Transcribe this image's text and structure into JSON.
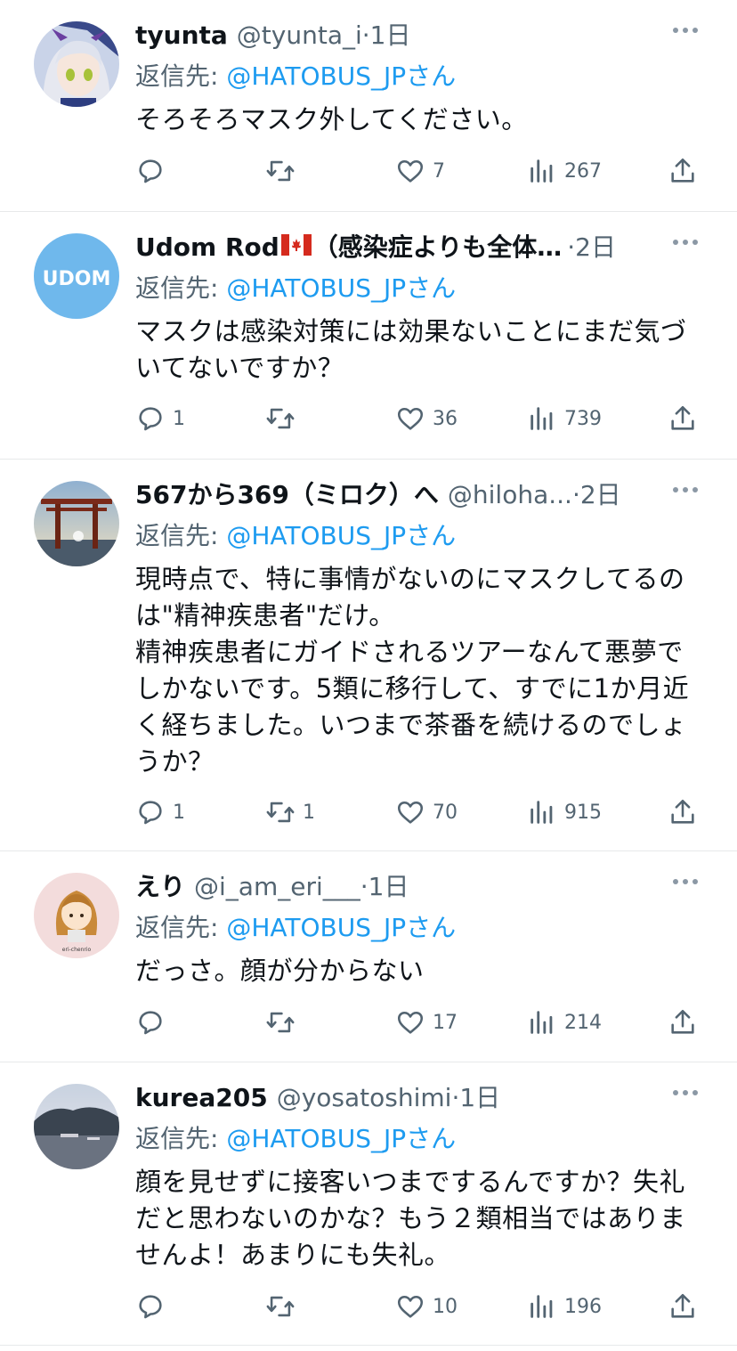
{
  "tweets": [
    {
      "name": "tyunta",
      "handle": "@tyunta_i",
      "time": "1日",
      "reply_prefix": "返信先:",
      "reply_to": "@HATOBUS_JPさん",
      "text": "そろそろマスク外してください。",
      "counts": {
        "reply": "",
        "retweet": "",
        "like": "7",
        "views": "267"
      },
      "avatar": "anime-character-avatar"
    },
    {
      "name": "Udom Rod",
      "name_suffix": "（感染症よりも全体…",
      "flag": "canada-flag",
      "handle": "",
      "time": "2日",
      "reply_prefix": "返信先:",
      "reply_to": "@HATOBUS_JPさん",
      "text": "マスクは感染対策には効果ないことにまだ気づいてないですか？",
      "counts": {
        "reply": "1",
        "retweet": "",
        "like": "36",
        "views": "739"
      },
      "avatar_text": "UDOM",
      "avatar": "udom-logo-avatar"
    },
    {
      "name": "567から369（ミロク）へ",
      "handle": "@hiloha...",
      "time": "2日",
      "reply_prefix": "返信先:",
      "reply_to": "@HATOBUS_JPさん",
      "text": "現時点で、特に事情がないのにマスクしてるのは\"精神疾患者\"だけ。\n精神疾患者にガイドされるツアーなんて悪夢でしかないです。5類に移行して、すでに1か月近く経ちました。いつまで茶番を続けるのでしょうか？",
      "counts": {
        "reply": "1",
        "retweet": "1",
        "like": "70",
        "views": "915"
      },
      "avatar": "torii-gate-avatar"
    },
    {
      "name": "えり",
      "handle": "@i_am_eri___",
      "time": "1日",
      "reply_prefix": "返信先:",
      "reply_to": "@HATOBUS_JPさん",
      "text": "だっさ。顔が分からない",
      "counts": {
        "reply": "",
        "retweet": "",
        "like": "17",
        "views": "214"
      },
      "avatar_text": "eri-chenrio",
      "avatar": "girl-illustration-avatar"
    },
    {
      "name": "kurea205",
      "handle": "@yosatoshimi",
      "time": "1日",
      "reply_prefix": "返信先:",
      "reply_to": "@HATOBUS_JPさん",
      "text": "顔を見せずに接客いつまでするんですか？失礼だと思わないのかな？もう２類相当ではありませんよ！あまりにも失礼。",
      "counts": {
        "reply": "",
        "retweet": "",
        "like": "10",
        "views": "196"
      },
      "avatar": "harbor-photo-avatar"
    }
  ],
  "sep": "·",
  "icons": {
    "reply": "reply-icon",
    "retweet": "retweet-icon",
    "like": "heart-icon",
    "views": "views-icon",
    "share": "share-icon",
    "more": "more-icon"
  },
  "colors": {
    "link": "#1d9bf0",
    "secondary": "#536471",
    "divider": "#e7e9ea"
  }
}
